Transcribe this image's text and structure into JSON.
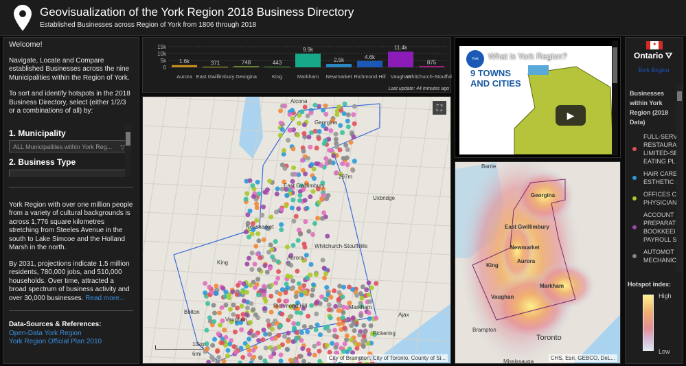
{
  "header": {
    "title": "Geovisualization of the York Region 2018 Business Directory",
    "subtitle": "Established Businesses across Region of York from 1806 through 2018"
  },
  "left": {
    "welcome": "Welcome!",
    "intro": "Navigate, Locate and Compare established Businesses across the nine Municipalities within the Region of York.",
    "instructions": "To sort and identify hotspots in the 2018 Business Directory, select  (either 1/2/3 or a combinations of all) by:",
    "municipality_heading": "1. Municipality",
    "municipality_value": "ALL Municipalities within York Reg...",
    "business_heading": "2. Business Type",
    "desc1": "York Region with over one million people from a variety of cultural backgrounds is across 1,776 square kilometres stretching from Steeles Avenue in the south to Lake Simcoe and the Holland Marsh in the north.",
    "desc2": "By 2031, projections indicate 1.5 million residents, 780,000 jobs, and 510,000 households. Over time, attracted a broad spectrum of business activity and over 30,000 businesses. ",
    "read_more": "Read more...",
    "sources_heading": "Data-Sources & References:",
    "links": [
      "Open-Data York Region",
      "York Region Official Plan 2010"
    ]
  },
  "chart_data": {
    "type": "bar",
    "categories": [
      "Aurora",
      "East Gwillimbury",
      "Georgina",
      "King",
      "Markham",
      "Newmarket",
      "Richmond Hill",
      "Vaughan",
      "Whitchurch-Stouffville"
    ],
    "values": [
      1600,
      371,
      748,
      443,
      9900,
      2500,
      4600,
      11400,
      875
    ],
    "labels": [
      "1.6k",
      "371",
      "748",
      "443",
      "9.9k",
      "2.5k",
      "4.6k",
      "11.4k",
      "875"
    ],
    "colors": [
      "#c58d1c",
      "#b7b42c",
      "#8bb53b",
      "#52a53a",
      "#17a88a",
      "#2887c0",
      "#1c58b5",
      "#8b1cb8",
      "#c01c9c"
    ],
    "yticks": [
      "0",
      "5k",
      "10k",
      "15k"
    ],
    "ylim": [
      0,
      15000
    ],
    "update": "Last update: 44 minutes ago"
  },
  "map": {
    "labels": [
      "Alcona",
      "Georgina",
      "Uxbridge",
      "Newmarket",
      "Aurora",
      "King",
      "Whitchurch-Stouffville",
      "East Gwillimbury",
      "Richmond Hill",
      "Vaughan",
      "Markham",
      "Pickering",
      "Ajax",
      "Bolton",
      "297m"
    ],
    "scale_km": "10km",
    "scale_mi": "6mi",
    "attribution": "City of Brampton, City of Toronto, County of Si..."
  },
  "video": {
    "title": "What is York Region?",
    "headline1": "9 TOWNS",
    "headline2": "AND CITIES",
    "logo": "York Region"
  },
  "heat": {
    "labels": [
      "Barrie",
      "Georgina",
      "East Gwillimbury",
      "Newmarket",
      "Aurora",
      "King",
      "Markham",
      "Vaughan",
      "Brampton",
      "Toronto",
      "Mississauga"
    ],
    "attribution": "CHS, Esri, GEBCO, DeL..."
  },
  "legend": {
    "ontario": "Ontario",
    "york": "York Region",
    "title": "Businesses within York Region (2018 Data)",
    "items": [
      {
        "label": "FULL-SERVICE RESTAURANTS, LIMITED-SERVICE EATING PLACES",
        "lines": [
          "FULL-SERV",
          "RESTAURA",
          "LIMITED-SE",
          "EATING PL"
        ],
        "color": "#e0505a"
      },
      {
        "label": "HAIR CARE, ESTHETIC SERVICES",
        "lines": [
          "HAIR CARE",
          "ESTHETIC S"
        ],
        "color": "#2a9ad8"
      },
      {
        "label": "OFFICES OF PHYSICIANS",
        "lines": [
          "OFFICES C",
          "PHYSICIAN"
        ],
        "color": "#a8c82a"
      },
      {
        "label": "ACCOUNTING, TAX PREPARATION, BOOKKEEPING, PAYROLL SERVICES",
        "lines": [
          "ACCOUNT",
          "PREPARATI",
          "BOOKKEEI",
          "PAYROLL S"
        ],
        "color": "#9a4aa8"
      },
      {
        "label": "AUTOMOTIVE MECHANICAL",
        "lines": [
          "AUTOMOT",
          "MECHANIC"
        ],
        "color": "#888"
      }
    ],
    "hotspot_title": "Hotspot index:",
    "high": "High",
    "low": "Low"
  }
}
